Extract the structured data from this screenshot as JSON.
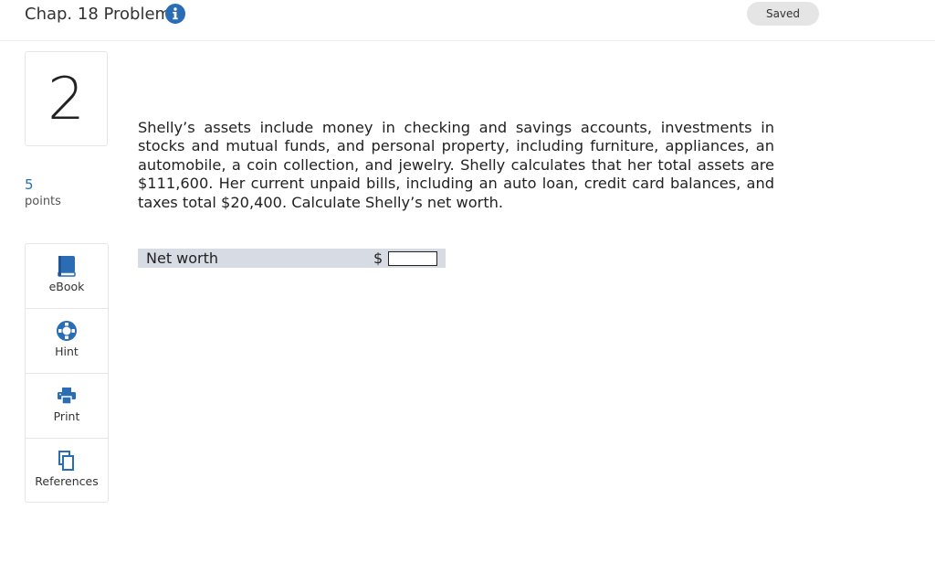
{
  "header": {
    "title": "Chap. 18 Problems",
    "saved_label": "Saved"
  },
  "question": {
    "number": "2",
    "points_value": "5",
    "points_label": "points",
    "text": "Shelly’s assets include money in checking and savings accounts, investments in stocks and mutual funds, and personal property, including furniture, appliances, an automobile, a coin collection, and jewelry. Shelly calculates that her total assets are $111,600. Her current unpaid bills, including an auto loan, credit card balances, and taxes total $20,400. Calculate Shelly’s net worth."
  },
  "answer": {
    "label": "Net worth",
    "currency": "$",
    "value": ""
  },
  "tools": [
    {
      "label": "eBook",
      "icon": "book-icon"
    },
    {
      "label": "Hint",
      "icon": "lifebuoy-icon"
    },
    {
      "label": "Print",
      "icon": "printer-icon"
    },
    {
      "label": "References",
      "icon": "copy-icon"
    }
  ],
  "colors": {
    "accent": "#2a6db5",
    "answer_row_bg": "#d7dbe4"
  }
}
